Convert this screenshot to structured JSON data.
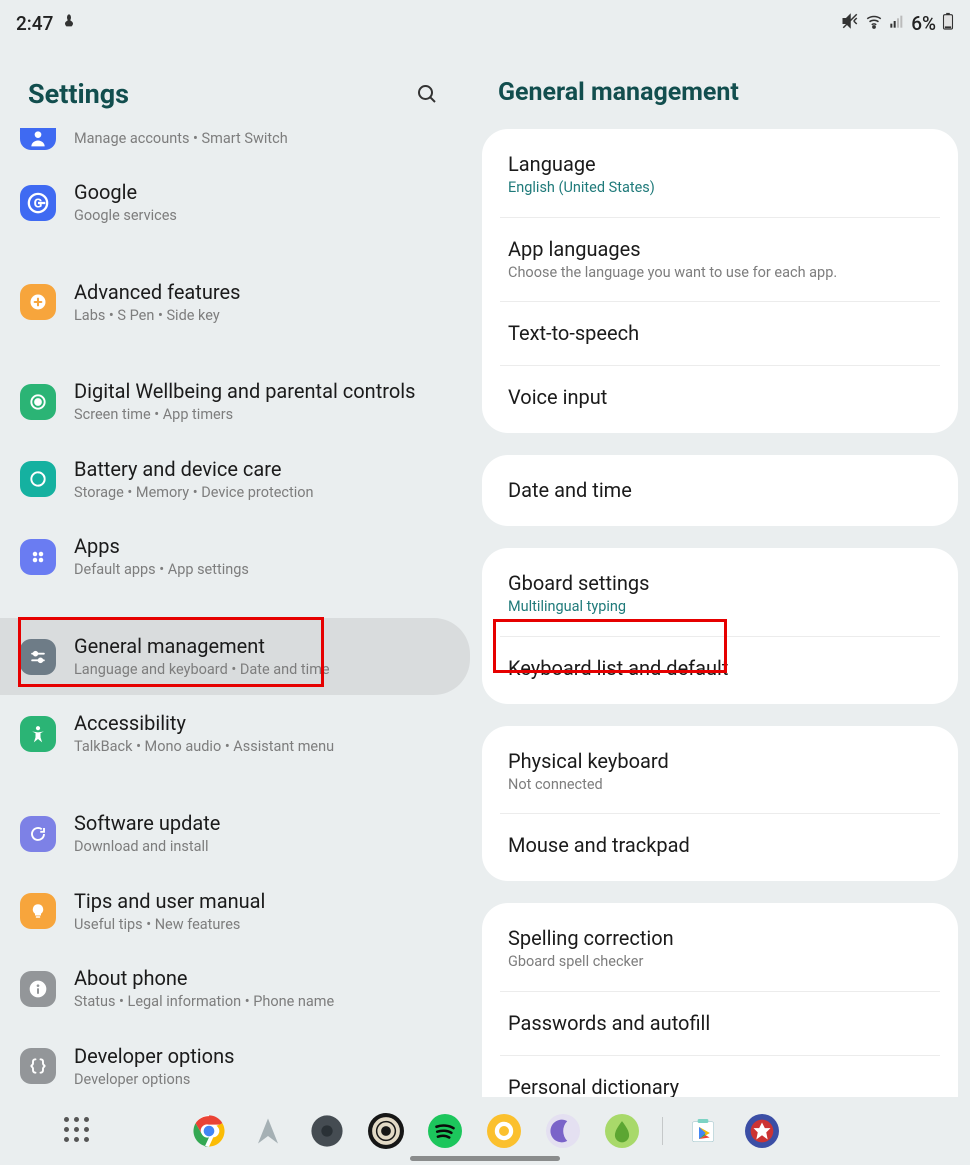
{
  "status": {
    "time": "2:47",
    "battery_pct": "6%"
  },
  "left": {
    "title": "Settings",
    "items": [
      {
        "id": "accounts",
        "icon_bg": "#3f6af2",
        "icon": "person",
        "title": "",
        "sub": "Manage accounts  •  Smart Switch",
        "partial": true
      },
      {
        "id": "google",
        "icon_bg": "#3f6af2",
        "icon": "g",
        "title": "Google",
        "sub": "Google services",
        "spacer_after": true
      },
      {
        "id": "advanced",
        "icon_bg": "#f7a53c",
        "icon": "gear-plus",
        "title": "Advanced features",
        "sub": "Labs  •  S Pen  •  Side key",
        "spacer_after": true
      },
      {
        "id": "wellbeing",
        "icon_bg": "#2bb475",
        "icon": "target",
        "title": "Digital Wellbeing and parental controls",
        "sub": "Screen time  •  App timers"
      },
      {
        "id": "battery",
        "icon_bg": "#15b1a0",
        "icon": "swirl",
        "title": "Battery and device care",
        "sub": "Storage  •  Memory  •  Device protection"
      },
      {
        "id": "apps",
        "icon_bg": "#6a7cf2",
        "icon": "four-dots",
        "title": "Apps",
        "sub": "Default apps  •  App settings",
        "spacer_after": true
      },
      {
        "id": "general",
        "icon_bg": "#6e7c87",
        "icon": "sliders",
        "title": "General management",
        "sub": "Language and keyboard  •  Date and time",
        "selected": true,
        "highlight": true
      },
      {
        "id": "accessibility",
        "icon_bg": "#2bb475",
        "icon": "accessibility",
        "title": "Accessibility",
        "sub": "TalkBack  •  Mono audio  •  Assistant menu",
        "spacer_after": true
      },
      {
        "id": "software",
        "icon_bg": "#7d81e6",
        "icon": "refresh",
        "title": "Software update",
        "sub": "Download and install"
      },
      {
        "id": "tips",
        "icon_bg": "#f7a53c",
        "icon": "bulb",
        "title": "Tips and user manual",
        "sub": "Useful tips  •  New features"
      },
      {
        "id": "about",
        "icon_bg": "#939699",
        "icon": "info",
        "title": "About phone",
        "sub": "Status  •  Legal information  •  Phone name"
      },
      {
        "id": "developer",
        "icon_bg": "#939699",
        "icon": "braces",
        "title": "Developer options",
        "sub": "Developer options"
      }
    ]
  },
  "right": {
    "title": "General management",
    "groups": [
      [
        {
          "title": "Language",
          "sub": "English (United States)",
          "sub_teal": true
        },
        {
          "title": "App languages",
          "sub": "Choose the language you want to use for each app."
        },
        {
          "title": "Text-to-speech"
        },
        {
          "title": "Voice input"
        }
      ],
      [
        {
          "title": "Date and time"
        }
      ],
      [
        {
          "title": "Gboard settings",
          "sub": "Multilingual typing",
          "sub_teal": true
        },
        {
          "title": "Keyboard list and default",
          "highlight": true
        }
      ],
      [
        {
          "title": "Physical keyboard",
          "sub": "Not connected"
        },
        {
          "title": "Mouse and trackpad"
        }
      ],
      [
        {
          "title": "Spelling correction",
          "sub": "Gboard spell checker"
        },
        {
          "title": "Passwords and autofill"
        },
        {
          "title": "Personal dictionary"
        }
      ]
    ]
  },
  "taskbar": {
    "apps": [
      {
        "name": "chrome",
        "bg": "#fff"
      },
      {
        "name": "send",
        "bg": "transparent"
      },
      {
        "name": "dark-circle",
        "bg": "#454c52"
      },
      {
        "name": "rings",
        "bg": "#161616"
      },
      {
        "name": "spotify",
        "bg": "#1cc65c"
      },
      {
        "name": "yellow-ring",
        "bg": "#fbc02d"
      },
      {
        "name": "moon",
        "bg": "#e4e0f1"
      },
      {
        "name": "green-droplet",
        "bg": "#a8d96a"
      },
      {
        "name": "sep"
      },
      {
        "name": "play-store",
        "bg": "transparent"
      },
      {
        "name": "badge-circle",
        "bg": "#3b4ea5"
      }
    ]
  }
}
